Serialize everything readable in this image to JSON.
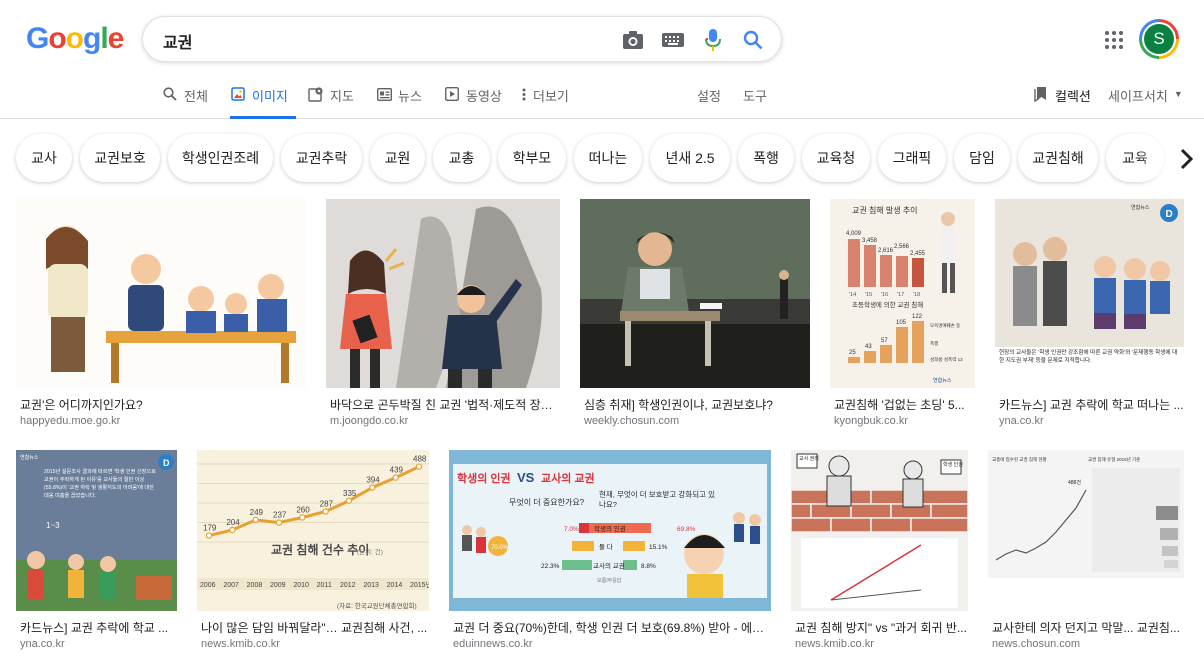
{
  "search": {
    "query": "교권"
  },
  "account": {
    "initial": "S"
  },
  "tabs": [
    {
      "label": "전체"
    },
    {
      "label": "이미지"
    },
    {
      "label": "지도"
    },
    {
      "label": "뉴스"
    },
    {
      "label": "동영상"
    },
    {
      "label": "더보기"
    },
    {
      "label": "설정"
    },
    {
      "label": "도구"
    }
  ],
  "right": {
    "collections": "컬렉션",
    "safesearch": "세이프서치"
  },
  "chips": [
    "교사",
    "교권보호",
    "학생인권조례",
    "교권추락",
    "교원",
    "교총",
    "학부모",
    "떠나는",
    "년새 2.5",
    "폭행",
    "교육청",
    "그래픽",
    "담임",
    "교권침해",
    "교육"
  ],
  "results_row1": [
    {
      "caption": "교권'은 어디까지인가요?",
      "source": "happyedu.moe.go.kr"
    },
    {
      "caption": "바닥으로 곤두박질 친 교권 '법적·제도적 장치...",
      "source": "m.joongdo.co.kr"
    },
    {
      "caption": "심층 취재] 학생인권이냐, 교권보호냐?",
      "source": "weekly.chosun.com"
    },
    {
      "caption": "교권침해 '겁없는 초딩' 5...",
      "source": "kyongbuk.co.kr"
    },
    {
      "caption": "카드뉴스] 교권 추락에 학교 떠나는 ...",
      "source": "yna.co.kr"
    }
  ],
  "results_row2": [
    {
      "caption": "카드뉴스] 교권 추락에 학교 ...",
      "source": "yna.co.kr"
    },
    {
      "caption": "나이 많은 담임 바꿔달라\"… 교권침해 사건, ...",
      "source": "news.kmib.co.kr"
    },
    {
      "caption": "교권 더 중요(70%)한데, 학생 인권 더 보호(69.8%) 받아 - 에듀...",
      "source": "eduinnews.co.kr"
    },
    {
      "caption": "교권 침해 방지\" vs \"과거 회귀 반...",
      "source": "news.kmib.co.kr"
    },
    {
      "caption": "교사한테 의자 던지고 막말... 교권침...",
      "source": "news.chosun.com"
    }
  ],
  "thumb_texts": {
    "chart1_title": "교권 침해 발생 추이",
    "chart1_values": [
      "4,009",
      "3,458",
      "2,616",
      "2,566",
      "2,455"
    ],
    "chart1_years": [
      "'14",
      "'15",
      "'16",
      "'17",
      "'18"
    ],
    "chart1_sub": "초등학생에 의한 교권 침해",
    "chart1_values2": [
      "25",
      "43",
      "57",
      "105",
      "122"
    ],
    "chart1_legend": [
      "모욕명예훼손 등",
      "폭행",
      "성희롱·성폭력 13"
    ],
    "chart1_credit": "연합뉴스",
    "card_text": "현장의 교사들은 '학생 인권만 강조함에 따른 교권 약화'와 '문제행동 학생에 대한 지도권 부재' 등을 문제로 지적합니다.",
    "card2_text": "2015년 설문조사 결과에 따르면 '학생 인권 신장으로 교권이 추락하게 된 이유'를 교사들의 절반 이상(55.8%)이 '교권 하락 및 생활지도의 어려움'에 대한 대응 미흡을 꼽았습니다.",
    "card2_ratio": "1~3",
    "card_logo": "연합뉴스",
    "line_values": [
      "179",
      "204",
      "249",
      "237",
      "260",
      "287",
      "335",
      "394",
      "439",
      "488"
    ],
    "line_years": [
      "2006",
      "2007",
      "2008",
      "2009",
      "2010",
      "2011",
      "2012",
      "2013",
      "2014",
      "2015년"
    ],
    "line_title": "교권 침해 건수 추이",
    "line_unit": "(단위: 건)",
    "line_source": "(자료: 한국교원단체총연합회)",
    "vs_title_left": "학생의 인권",
    "vs_mid": "VS",
    "vs_title_right": "교사의 교권",
    "vs_q1": "무엇이 더 중요한가요?",
    "vs_q2": "현재, 무엇이 더 보호받고 강화되고 있나요?",
    "vs_rows": [
      {
        "left": "7.0%",
        "label": "학생의 인권",
        "right": "69.8%"
      },
      {
        "left": "70.0%",
        "label": "둘 다",
        "right": "15.1%"
      },
      {
        "left": "22.3%",
        "label": "교사의 교권",
        "right": "8.8%"
      }
    ],
    "vs_note": "모름/무응답",
    "cartoon_left": "교사 권리",
    "cartoon_right": "학생 인권",
    "chart3_title": "교총에 접수된 교권 침해 현황",
    "chart3_right_title": "교권 침해 유형 2016년 기준",
    "chart3_peak": "488건"
  }
}
